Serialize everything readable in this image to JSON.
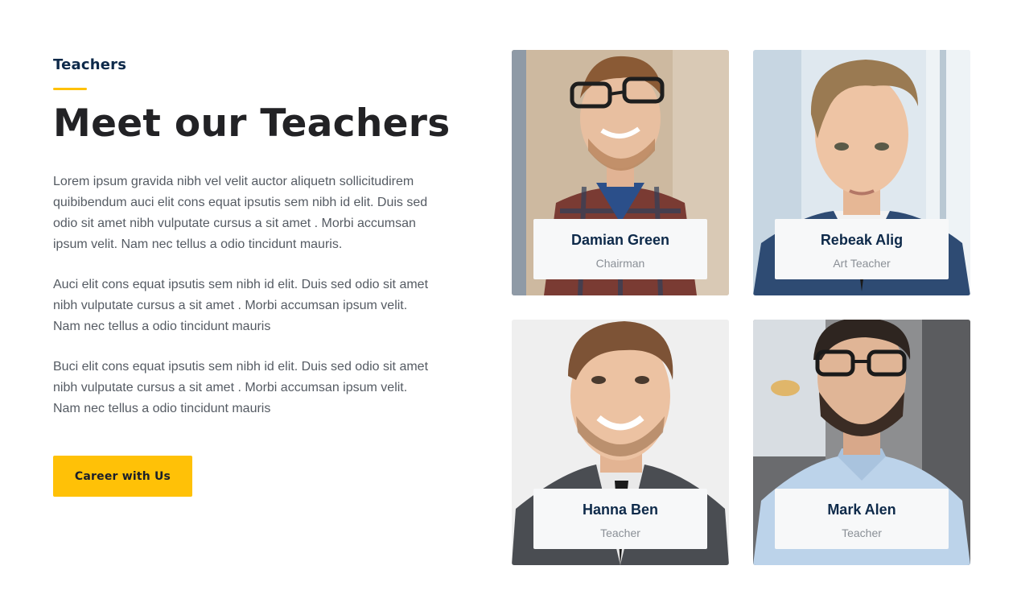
{
  "section": {
    "eyebrow": "Teachers",
    "title": "Meet our Teachers",
    "paragraphs": [
      "Lorem ipsum gravida nibh vel velit auctor aliquetn sollicitudirem quibibendum auci elit cons equat ipsutis sem nibh id elit. Duis sed odio sit amet nibh vulputate cursus a sit amet . Morbi accumsan ipsum velit. Nam nec tellus a odio tincidunt mauris.",
      "Auci elit cons equat ipsutis sem nibh id elit. Duis sed odio sit amet nibh vulputate cursus a sit amet . Morbi accumsan ipsum velit. Nam nec tellus a odio tincidunt mauris",
      "Buci elit cons equat ipsutis sem nibh id elit. Duis sed odio sit amet nibh vulputate cursus a sit amet . Morbi accumsan ipsum velit. Nam nec tellus a odio tincidunt mauris"
    ],
    "cta_label": "Career with Us"
  },
  "teachers": [
    {
      "name": "Damian Green",
      "role": "Chairman"
    },
    {
      "name": "Rebeak Alig",
      "role": "Art Teacher"
    },
    {
      "name": "Hanna Ben",
      "role": "Teacher"
    },
    {
      "name": "Mark Alen",
      "role": "Teacher"
    }
  ],
  "colors": {
    "accent": "#ffc107",
    "heading": "#222225",
    "navy": "#0e2a4a",
    "body_text": "#555b63",
    "card_label_bg": "#f7f8f9"
  }
}
